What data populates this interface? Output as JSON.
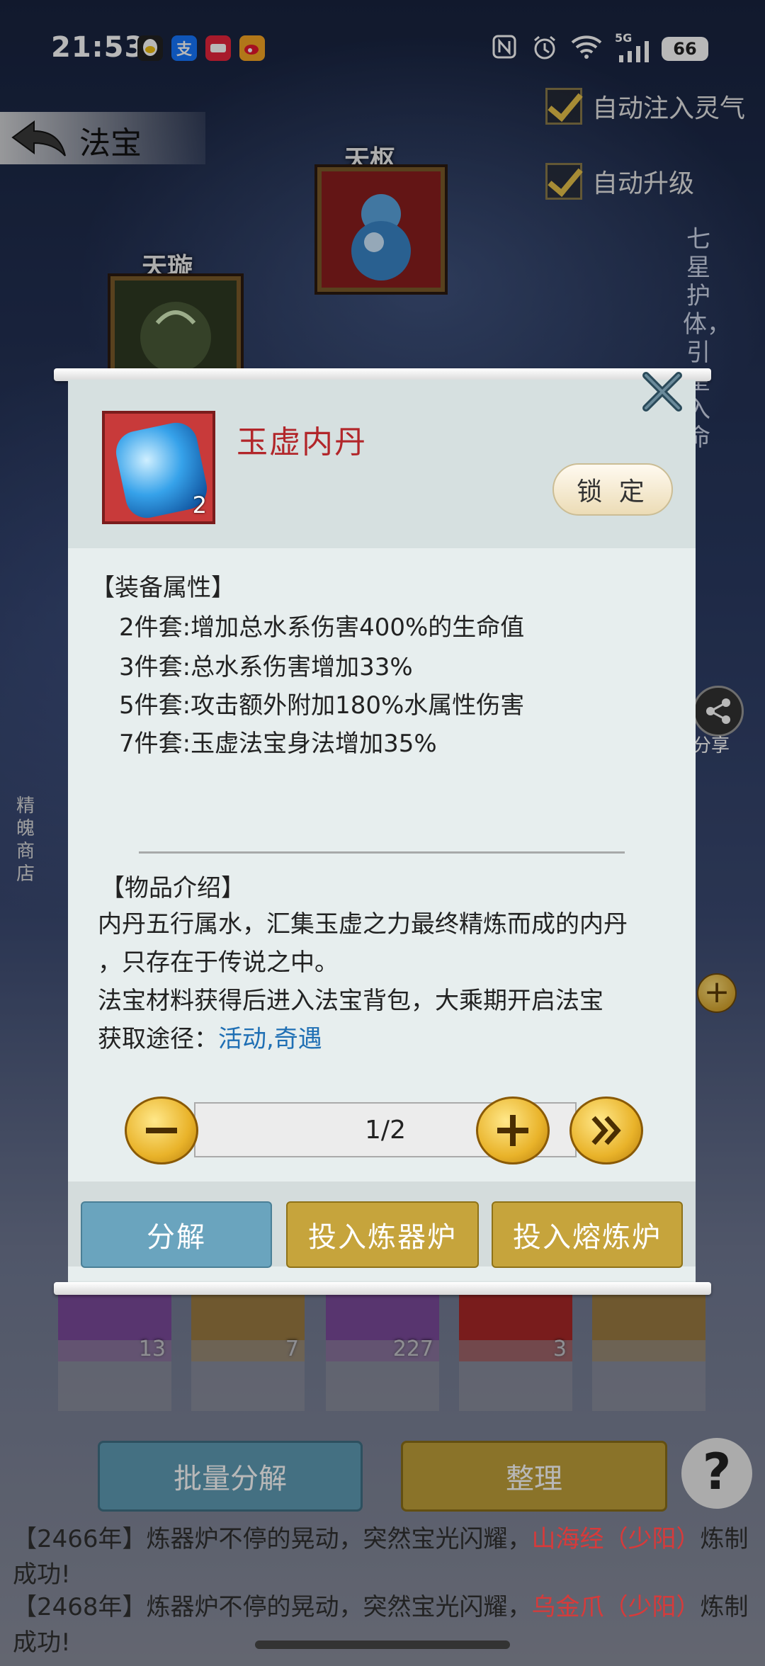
{
  "status_bar": {
    "time": "21:53",
    "apps": [
      "qq-icon",
      "alipay-icon",
      "xiaohongshu-icon",
      "weibo-icon"
    ],
    "alipay_char": "支",
    "network": "5G",
    "battery": "66"
  },
  "header": {
    "title": "法宝"
  },
  "options": {
    "auto_inject": "自动注入灵气",
    "auto_upgrade": "自动升级"
  },
  "slots": {
    "tianshu": "天枢",
    "tianxuan": "天璇"
  },
  "side": {
    "seven_stars": "七星护体，引星入命",
    "shop": "精魄商店",
    "share": "分享"
  },
  "inventory_counts": [
    "13",
    "7",
    "227",
    "3"
  ],
  "bottom": {
    "batch_decompose": "批量分解",
    "organize": "整理",
    "help": "?"
  },
  "log": [
    {
      "prefix": "【2466年】炼器炉不停的晃动，突然宝光闪耀，",
      "item": "山海经（少阳）",
      "suffix": "炼制成功!"
    },
    {
      "prefix": "【2468年】炼器炉不停的晃动，突然宝光闪耀，",
      "item": "乌金爪（少阳）",
      "suffix": "炼制成功!"
    }
  ],
  "dialog": {
    "item_name": "玉虚内丹",
    "item_count": "2",
    "lock_label": "锁 定",
    "attr_title": "【装备属性】",
    "attributes": [
      "2件套:增加总水系伤害400%的生命值",
      "3件套:总水系伤害增加33%",
      "5件套:攻击额外附加180%水属性伤害",
      "7件套:玉虚法宝身法增加35%"
    ],
    "intro_title": "【物品介绍】",
    "intro_line1": "内丹五行属水，汇集玉虚之力最终精炼而成的内丹",
    "intro_line2": "，只存在于传说之中。",
    "intro_line3": "法宝材料获得后进入法宝背包，大乘期开启法宝",
    "source_label": "获取途径：",
    "source_value": "活动,奇遇",
    "pager": "1/2",
    "actions": {
      "decompose": "分解",
      "refiner": "投入炼器炉",
      "smelter": "投入熔炼炉"
    }
  },
  "colors": {
    "item_name": "#b2262a",
    "link": "#1f6fb4",
    "decompose_btn": "#6aa4be",
    "gold_btn": "#c6a43c",
    "highlight": "#d83a3a"
  }
}
